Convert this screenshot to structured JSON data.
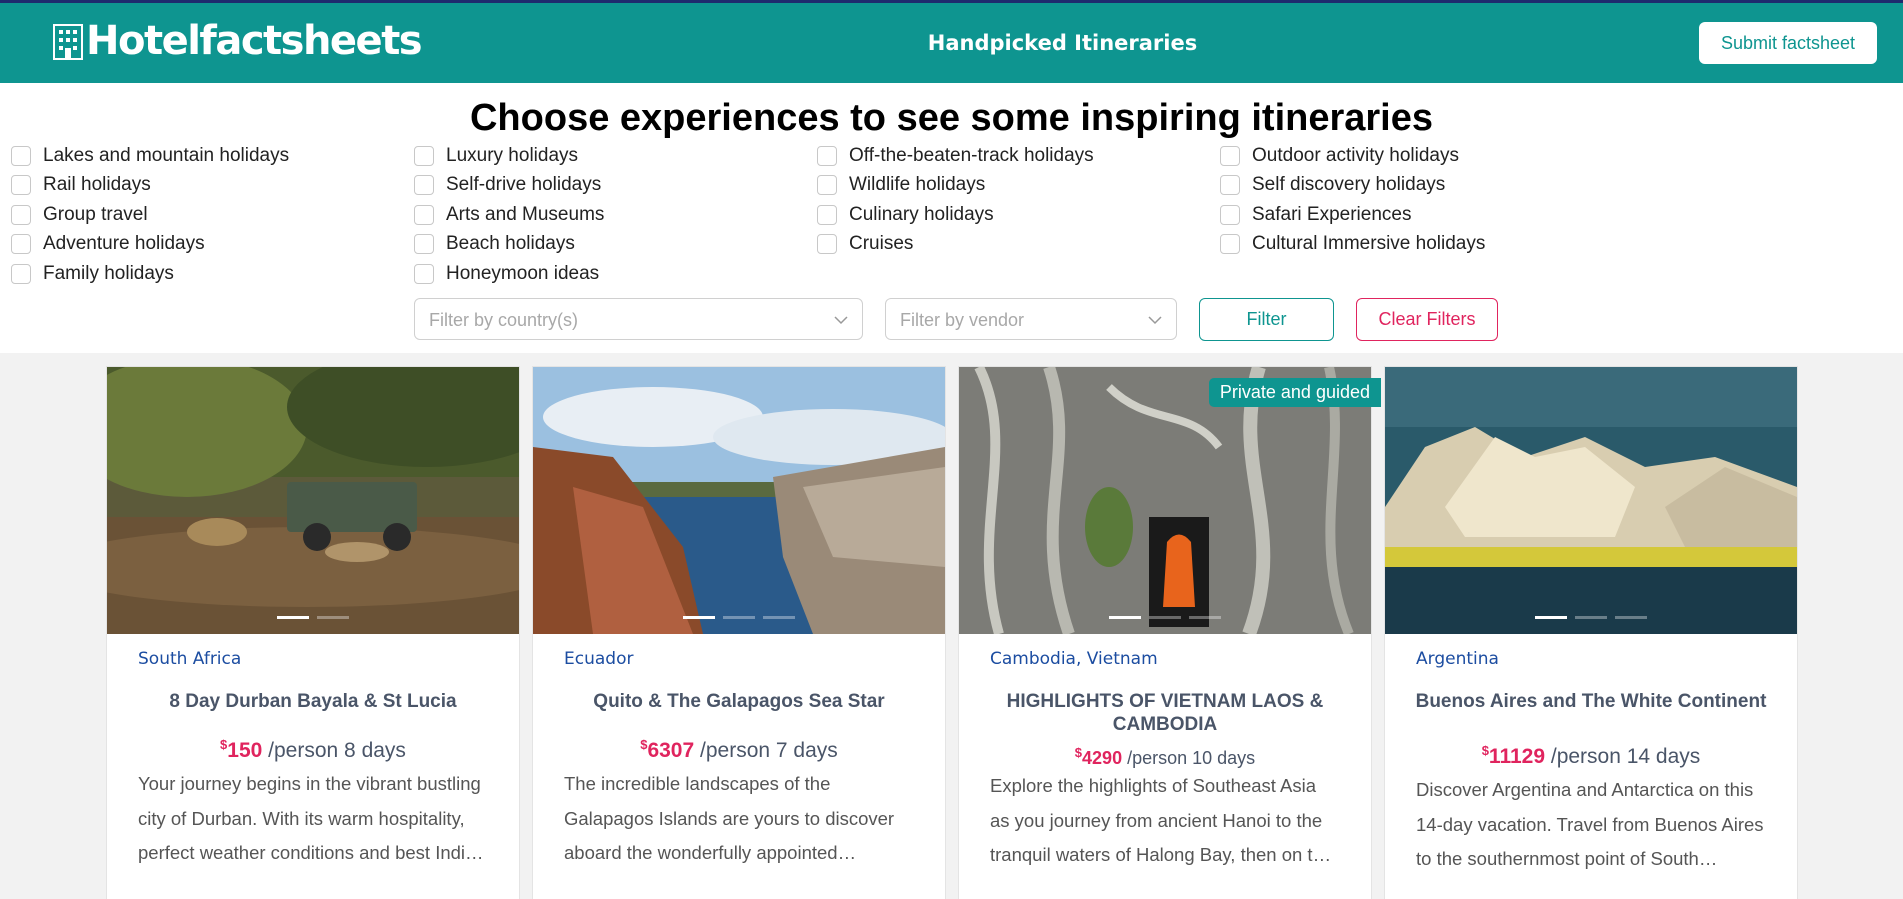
{
  "header": {
    "logo_text": "Hotelfactsheets",
    "center_title": "Handpicked Itineraries",
    "submit_label": "Submit factsheet"
  },
  "page_title": "Choose experiences to see some inspiring itineraries",
  "experiences": {
    "col1": [
      "Lakes and mountain holidays",
      "Rail holidays",
      "Group travel",
      "Adventure holidays",
      "Family holidays"
    ],
    "col2": [
      "Luxury holidays",
      "Self-drive holidays",
      "Arts and Museums",
      "Beach holidays",
      "Honeymoon ideas"
    ],
    "col3": [
      "Off-the-beaten-track holidays",
      "Wildlife holidays",
      "Culinary holidays",
      "Cruises"
    ],
    "col4": [
      "Outdoor activity holidays",
      "Self discovery holidays",
      "Safari Experiences",
      "Cultural Immersive holidays"
    ]
  },
  "filters": {
    "country_placeholder": "Filter by country(s)",
    "vendor_placeholder": "Filter by vendor",
    "filter_label": "Filter",
    "clear_label": "Clear Filters"
  },
  "cards": [
    {
      "country": "South Africa",
      "title": "8 Day Durban Bayala & St Lucia",
      "currency": "$",
      "price": "150",
      "price_suffix": "/person 8 days",
      "desc": [
        "Your journey begins in the vibrant bustling",
        "city of Durban. With its warm hospitality,",
        "perfect weather conditions and best Indian curry"
      ]
    },
    {
      "country": "Ecuador",
      "title": "Quito & The Galapagos Sea Star",
      "currency": "$",
      "price": "6307",
      "price_suffix": "/person 7 days",
      "desc": [
        "The incredible landscapes of the",
        "Galapagos Islands are yours to discover",
        "aboard the wonderfully appointed…"
      ]
    },
    {
      "country": "Cambodia, Vietnam",
      "title": "HIGHLIGHTS OF VIETNAM LAOS & CAMBODIA",
      "badge": "Private and guided",
      "currency": "$",
      "price": "4290",
      "price_suffix": "/person 10 days",
      "desc": [
        "Explore the highlights of Southeast Asia",
        "as you journey from ancient Hanoi to the",
        "tranquil waters of Halong Bay, then on to Laos"
      ]
    },
    {
      "country": "Argentina",
      "title": "Buenos Aires and The White Continent",
      "currency": "$",
      "price": "11129",
      "price_suffix": "/person 14 days",
      "desc": [
        "Discover Argentina and Antarctica on this",
        "14-day vacation. Travel from Buenos Aires",
        "to the southernmost point of South…"
      ]
    }
  ],
  "colors": {
    "brand": "#0e9590",
    "accent": "#e0245e",
    "link": "#1c4da1"
  }
}
